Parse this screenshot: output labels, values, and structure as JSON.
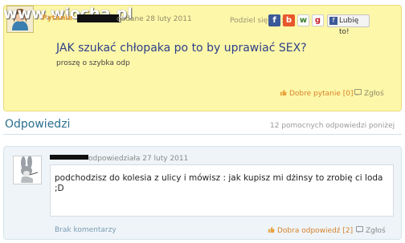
{
  "site": {
    "watermark": "www.wiocha.pl"
  },
  "question": {
    "asker_label": "Pytanie",
    "date": "dodane 28 luty 2011",
    "share_label": "Podziel się na :",
    "share_icons": [
      "facebook-icon",
      "blip-icon",
      "wykop-icon",
      "grono-icon"
    ],
    "like_label": "Lubię to!",
    "title": "JAK szukać chłopaka po to by uprawiać SEX?",
    "description": "proszę o szybka odp",
    "good_question": "Dobre pytanie [0]",
    "report": "Zgłoś",
    "colors": {
      "background": "#fdf7a9",
      "title": "#2c3f8a",
      "accent": "#d8822b"
    }
  },
  "answers_section": {
    "title": "Odpowiedzi",
    "count_text": "12 pomocnych odpowiedzi poniżej"
  },
  "answer": {
    "date": "odpowiedziała 27 luty 2011",
    "text": "podchodzisz do kolesia z ulicy i mówisz : jak kupisz mi dżinsy to zrobię ci loda ;D",
    "comments": "Brak komentarzy",
    "good_answer": "Dobra odpowiedź [2]",
    "report": "Zgłoś",
    "colors": {
      "background": "#eef4f8",
      "link": "#7a9cb3"
    }
  }
}
